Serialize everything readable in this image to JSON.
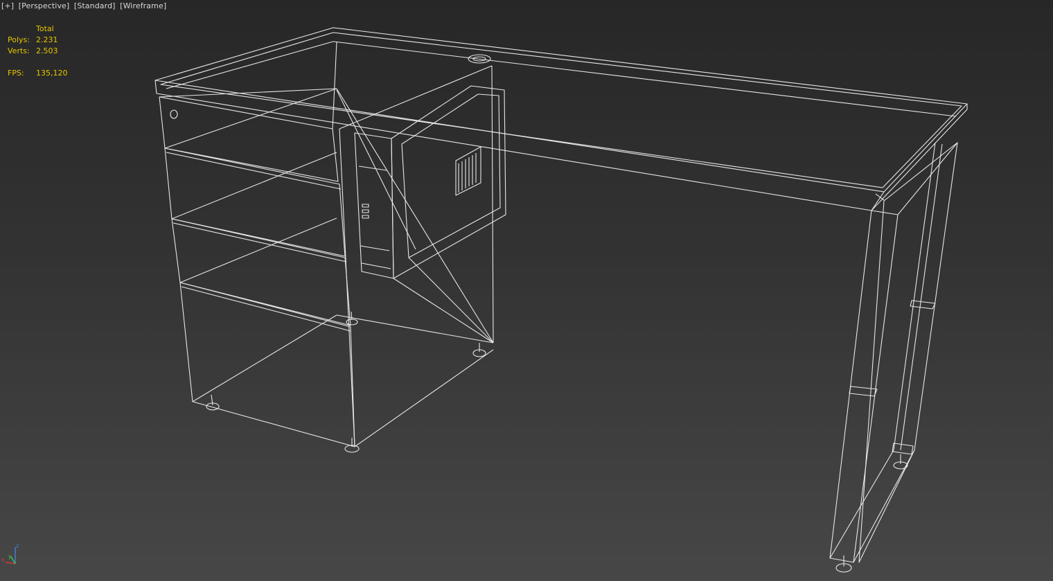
{
  "viewport": {
    "labels": [
      "[+]",
      "[Perspective]",
      "[Standard]",
      "[Wireframe]"
    ]
  },
  "stats": {
    "header": "Total",
    "polys_label": "Polys:",
    "polys_value": "2.231",
    "verts_label": "Verts:",
    "verts_value": "2.503",
    "fps_label": "FPS:",
    "fps_value": "135,120"
  },
  "axis": {
    "x": "x",
    "y": "y",
    "z": "z"
  },
  "colors": {
    "wire": "#e8e8e8",
    "stats_text": "#e6c600",
    "axis_x": "#d23c3c",
    "axis_y": "#3ccd3c",
    "axis_z": "#4a78e0"
  }
}
